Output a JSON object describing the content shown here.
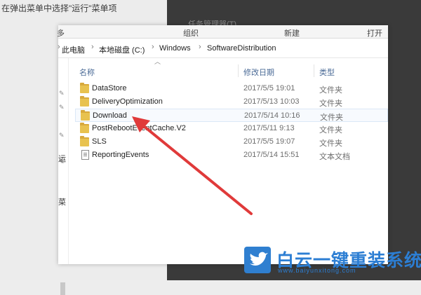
{
  "background": {
    "caption": "在弹出菜单中选择\"运行\"菜单项",
    "dark_text_1": "",
    "dark_text_2": "任务管理器(T)"
  },
  "ribbon": {
    "left_edge": "多",
    "organize": "组织",
    "new": "新建",
    "open": "打开"
  },
  "breadcrumb": [
    "此电脑",
    "本地磁盘 (C:)",
    "Windows",
    "SoftwareDistribution"
  ],
  "left_nav": {
    "fragment_1": "运",
    "fragment_2": "菜"
  },
  "columns": {
    "name": "名称",
    "date": "修改日期",
    "type": "类型"
  },
  "files": [
    {
      "name": "DataStore",
      "date": "2017/5/5 19:01",
      "type": "文件夹",
      "icon": "folder-icon"
    },
    {
      "name": "DeliveryOptimization",
      "date": "2017/5/13 10:03",
      "type": "文件夹",
      "icon": "folder-icon"
    },
    {
      "name": "Download",
      "date": "2017/5/14 10:16",
      "type": "文件夹",
      "icon": "folder-icon"
    },
    {
      "name": "PostRebootEventCache.V2",
      "date": "2017/5/11 9:13",
      "type": "文件夹",
      "icon": "folder-icon"
    },
    {
      "name": "SLS",
      "date": "2017/5/5 19:07",
      "type": "文件夹",
      "icon": "folder-icon"
    },
    {
      "name": "ReportingEvents",
      "date": "2017/5/14 15:51",
      "type": "文本文档",
      "icon": "text-file-icon"
    }
  ],
  "selected_file": "Download",
  "watermark": {
    "title": "白云一键重装系统",
    "url": "www.baiyunxitong.com"
  },
  "colors": {
    "arrow": "#e03a3a",
    "folder": "#e8c24f",
    "logo": "#2c7ed3",
    "header_text": "#4a6a96"
  }
}
